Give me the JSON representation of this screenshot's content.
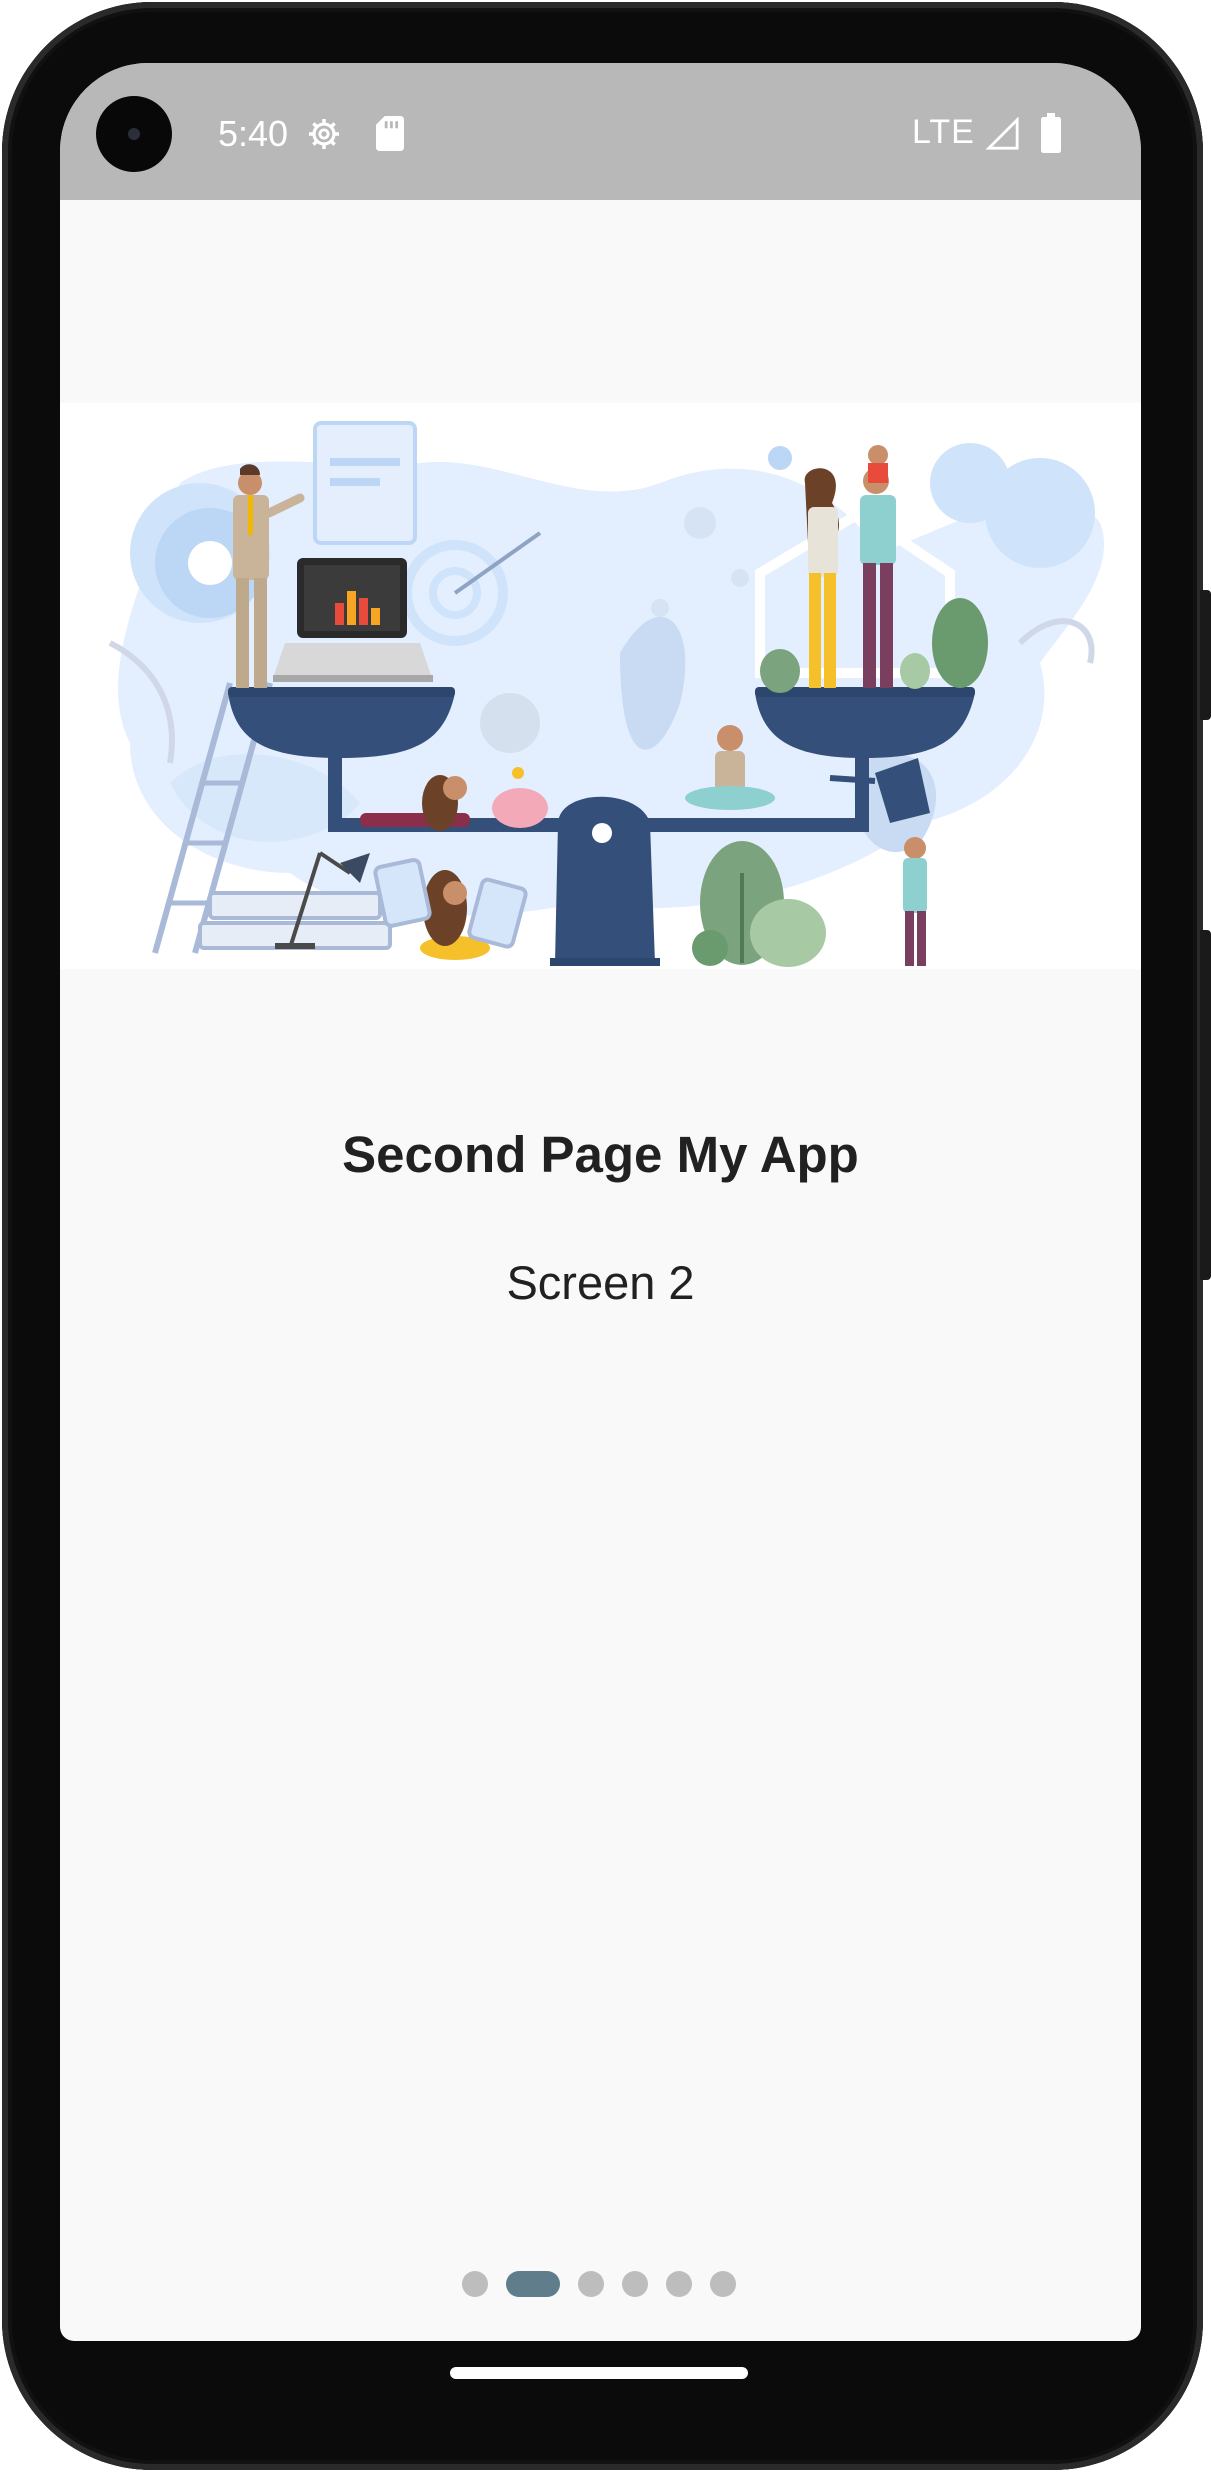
{
  "status_bar": {
    "time": "5:40",
    "network": "LTE",
    "icons": [
      "gear-icon",
      "sd-card-icon",
      "signal-icon",
      "battery-icon"
    ]
  },
  "page": {
    "title": "Second Page My App",
    "subtitle": "Screen 2"
  },
  "pager": {
    "count": 6,
    "active_index": 1,
    "active_color": "#607d8b",
    "inactive_color": "#bdbdbd"
  },
  "colors": {
    "status_bar_bg": "#b8b8b8",
    "screen_bg": "#f9f9f9",
    "text": "#212121",
    "illustration_navy": "#34507a",
    "illustration_light_blue": "#cfe3fb"
  }
}
